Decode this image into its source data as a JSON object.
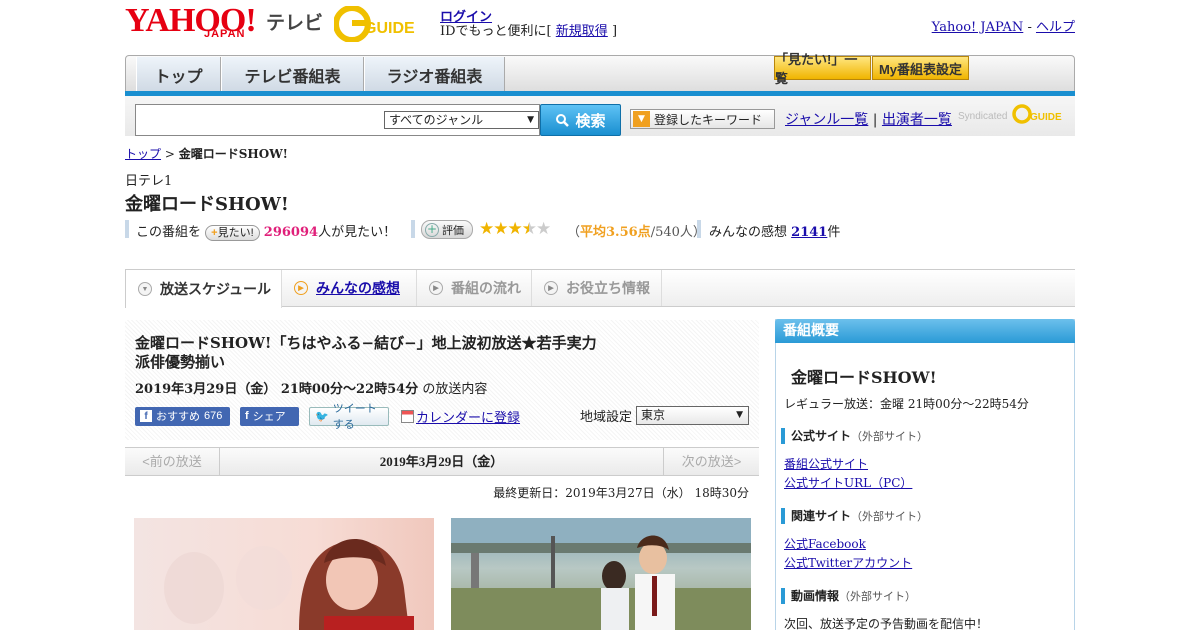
{
  "header": {
    "logo_yahoo": "YAHOO!",
    "logo_japan": "JAPAN",
    "logo_tv": "テレビ",
    "logo_gguide": "GUIDE",
    "login": "ログイン",
    "login_sub_prefix": "IDでもっと便利に[",
    "signup": "新規取得",
    "login_sub_suffix": "]",
    "yahoo_japan": "Yahoo! JAPAN",
    "separator": "-",
    "help": "ヘルプ"
  },
  "nav": {
    "tabs": [
      "トップ",
      "テレビ番組表",
      "ラジオ番組表"
    ],
    "mitai_list": "「見たい!」一覧",
    "my_schedule": "My番組表設定"
  },
  "search": {
    "genre": "すべてのジャンル",
    "button": "検索",
    "keyword_btn": "登録したキーワード",
    "genre_list": "ジャンル一覧",
    "divider": "|",
    "performer_list": "出演者一覧",
    "syndicated": "Syndicated"
  },
  "breadcrumb": {
    "top": "トップ",
    "sep": ">",
    "current": "金曜ロードSHOW!"
  },
  "program": {
    "channel": "日テレ1",
    "title": "金曜ロードSHOW!",
    "this_program": "この番組を",
    "mitai_btn": "見たい!",
    "mitai_count": "296094",
    "mitai_suffix": "人が見たい！",
    "rate_btn": "評価",
    "rating": 3.56,
    "rating_prefix": "（",
    "rating_label": "平均3.56点",
    "rating_people": "/540人）",
    "impressions_label": "みんなの感想",
    "impressions_count": "2141",
    "impressions_suffix": "件"
  },
  "tabs": [
    {
      "label": "放送スケジュール",
      "active": true
    },
    {
      "label": "みんなの感想",
      "active": false
    },
    {
      "label": "番組の流れ",
      "active": false
    },
    {
      "label": "お役立ち情報",
      "active": false
    }
  ],
  "episode": {
    "title": "金曜ロードSHOW!「ちはやふる−結び−」地上波初放送★若手実力派俳優勢揃い",
    "date": "2019年3月29日（金） 21時00分～22時54分",
    "date_suffix": "の放送内容",
    "fb_recommend": "おすすめ",
    "fb_count": "676",
    "fb_share": "シェア",
    "tweet": "ツイートする",
    "calendar": "カレンダーに登録",
    "region_label": "地域設定",
    "region": "東京"
  },
  "pager": {
    "prev": "<前の放送",
    "current": "2019年3月29日（金）",
    "next": "次の放送>"
  },
  "updated": "最終更新日：2019年3月27日（水） 18時30分",
  "sidebar": {
    "header": "番組概要",
    "title": "金曜ロードSHOW!",
    "regular": "レギュラー放送：金曜 21時00分～22時54分",
    "official_sec": "公式サイト",
    "external": "（外部サイト）",
    "official_link1": "番組公式サイト",
    "official_link2": "公式サイトURL（PC）",
    "related_sec": "関連サイト",
    "related_link1": "公式Facebook",
    "related_link2": "公式Twitterアカウント",
    "video_sec": "動画情報",
    "video_text": "次回、放送予定の予告動画を配信中！"
  },
  "colors": {
    "accent_blue": "#1a8fd0",
    "yahoo_red": "#e60012",
    "gguide_yellow": "#f0c000",
    "count_pink": "#e0207a",
    "star_gold": "#f0b400"
  }
}
